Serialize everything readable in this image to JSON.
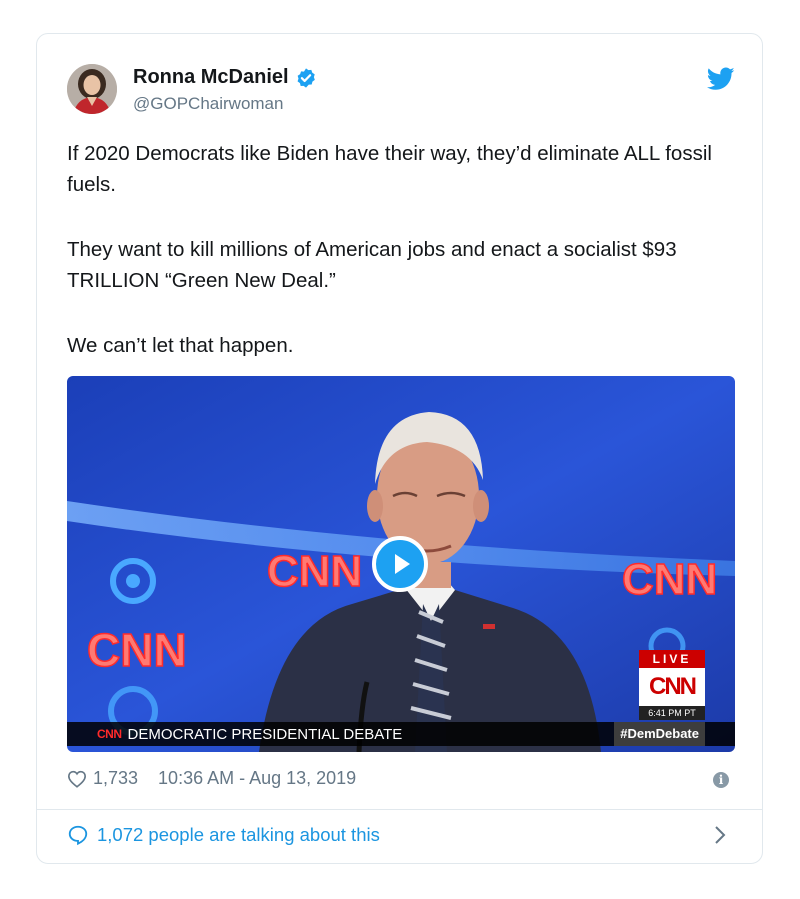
{
  "tweet": {
    "author_name": "Ronna McDaniel",
    "author_handle": "@GOPChairwoman",
    "verified": true,
    "paragraphs": [
      "If 2020 Democrats like Biden have their way, they’d eliminate ALL fossil fuels.",
      "They want to kill millions of American jobs and enact a socialist $93 TRILLION “Green New Deal.”",
      "We can’t let that happen."
    ],
    "likes": "1,733",
    "timestamp": "10:36 AM - Aug 13, 2019",
    "talking": "1,072 people are talking about this"
  },
  "video": {
    "background_logos": [
      "CNN",
      "CNN",
      "CNN"
    ],
    "lower_third_logo": "CNN",
    "lower_third_text": "DEMOCRATIC PRESIDENTIAL DEBATE",
    "hashtag": "#DemDebate",
    "live_label": "LIVE",
    "live_network": "CNN",
    "live_time": "6:41 PM PT"
  },
  "colors": {
    "twitter_blue": "#1da1f2",
    "link_blue": "#1b95e0",
    "muted_text": "#657786",
    "cnn_red": "#cc0000"
  },
  "icons": {
    "verified": "verified-badge-icon",
    "bird": "twitter-bird-icon",
    "heart": "heart-icon",
    "info": "info-icon",
    "reply": "speech-bubble-icon",
    "chevron": "chevron-right-icon",
    "play": "play-icon"
  }
}
